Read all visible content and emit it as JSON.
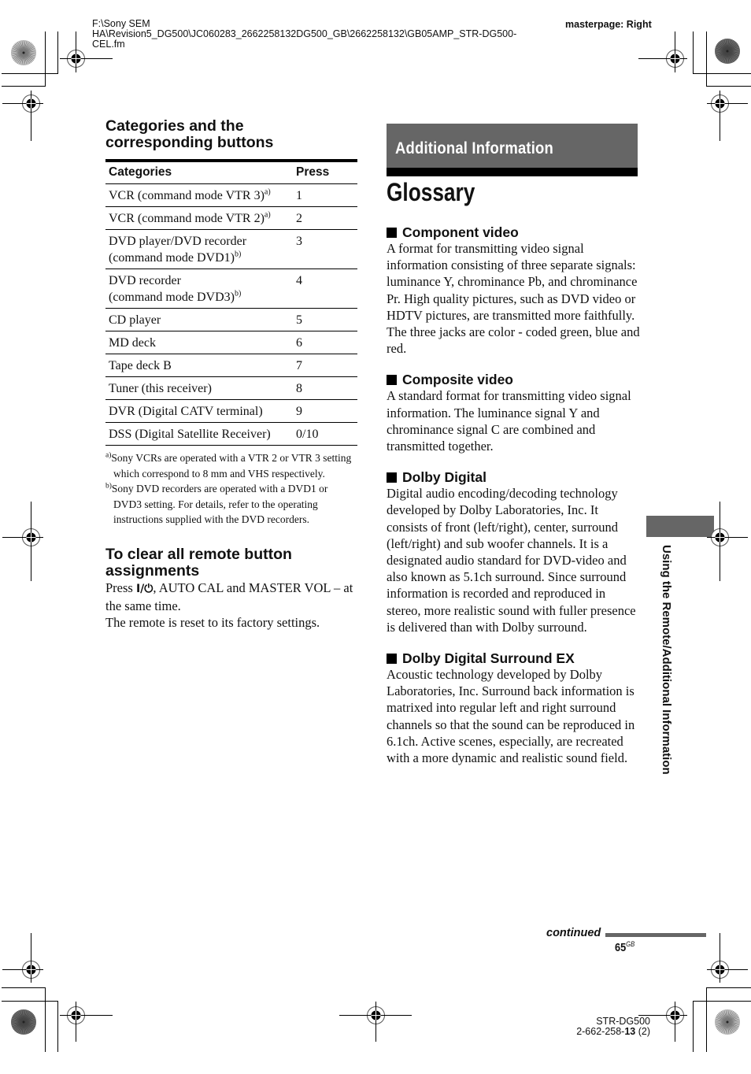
{
  "header": {
    "file_path_lines": [
      "F:\\Sony SEM",
      "HA\\Revision5_DG500\\JC060283_2662258132DG500_GB\\2662258132\\GB05AMP_STR-DG500-",
      "CEL.fm"
    ],
    "masterpage": "masterpage: Right"
  },
  "left": {
    "categories_heading_line1": "Categories and the",
    "categories_heading_line2": "corresponding buttons",
    "table": {
      "headers": [
        "Categories",
        "Press"
      ],
      "rows": [
        {
          "category": "VCR (command mode VTR 3)",
          "note": "a)",
          "category2": "",
          "note2": "",
          "press": "1"
        },
        {
          "category": "VCR (command mode VTR 2)",
          "note": "a)",
          "category2": "",
          "note2": "",
          "press": "2"
        },
        {
          "category": "DVD player/DVD recorder",
          "note": "",
          "category2": "(command mode DVD1)",
          "note2": "b)",
          "press": "3"
        },
        {
          "category": "DVD recorder",
          "note": "",
          "category2": "(command mode DVD3)",
          "note2": "b)",
          "press": "4"
        },
        {
          "category": "CD player",
          "note": "",
          "category2": "",
          "note2": "",
          "press": "5"
        },
        {
          "category": "MD deck",
          "note": "",
          "category2": "",
          "note2": "",
          "press": "6"
        },
        {
          "category": "Tape deck B",
          "note": "",
          "category2": "",
          "note2": "",
          "press": "7"
        },
        {
          "category": "Tuner (this receiver)",
          "note": "",
          "category2": "",
          "note2": "",
          "press": "8"
        },
        {
          "category": "DVR (Digital CATV terminal)",
          "note": "",
          "category2": "",
          "note2": "",
          "press": "9"
        },
        {
          "category": "DSS (Digital Satellite Receiver)",
          "note": "",
          "category2": "",
          "note2": "",
          "press": "0/10"
        }
      ]
    },
    "footnotes": [
      {
        "mark": "a)",
        "text": "Sony VCRs are operated with a VTR 2 or VTR 3 setting which correspond to 8 mm and VHS respectively."
      },
      {
        "mark": "b)",
        "text": "Sony DVD recorders are operated with a DVD1 or DVD3 setting. For details, refer to the operating instructions supplied with the DVD recorders."
      }
    ],
    "clear_heading_line1": "To clear all remote button",
    "clear_heading_line2": "assignments",
    "clear_text_pre": "Press ",
    "clear_text_power": "I/⏻",
    "clear_text_post": ", AUTO CAL and MASTER VOL – at the same time.",
    "clear_text_2": "The remote is reset to its factory settings."
  },
  "right": {
    "chapter_banner": "Additional Information",
    "title": "Glossary",
    "terms": [
      {
        "term": "Component video",
        "text": "A format for transmitting video signal information consisting of three separate signals: luminance Y, chrominance Pb, and chrominance Pr. High quality pictures, such as DVD video or HDTV pictures, are transmitted more faithfully. The three jacks are color - coded green, blue and red."
      },
      {
        "term": "Composite video",
        "text": "A standard format for transmitting video signal information. The luminance signal Y and chrominance signal C are combined and transmitted together."
      },
      {
        "term": "Dolby Digital",
        "text": "Digital audio encoding/decoding technology developed by Dolby Laboratories, Inc. It consists of front (left/right), center, surround (left/right) and sub woofer channels. It is a designated audio standard for DVD-video and also known as 5.1ch surround. Since surround information is recorded and reproduced in stereo, more realistic sound with fuller presence is delivered than with Dolby surround."
      },
      {
        "term": "Dolby Digital Surround EX",
        "text": "Acoustic technology developed by Dolby Laboratories, Inc. Surround back information is matrixed into regular left and right surround channels so that the sound can be reproduced in 6.1ch. Active scenes, especially, are recreated with a more dynamic and realistic sound field."
      }
    ]
  },
  "side_tab_label": "Using the Remote/Additional Information",
  "footer": {
    "continued": "continued",
    "page_number": "65",
    "page_suffix": "GB",
    "model": "STR-DG500",
    "part_prefix": "2-662-258-",
    "part_bold": "13",
    "part_suffix": " (2)"
  },
  "colors": {
    "banner_gray": "#666666",
    "text": "#111111"
  }
}
